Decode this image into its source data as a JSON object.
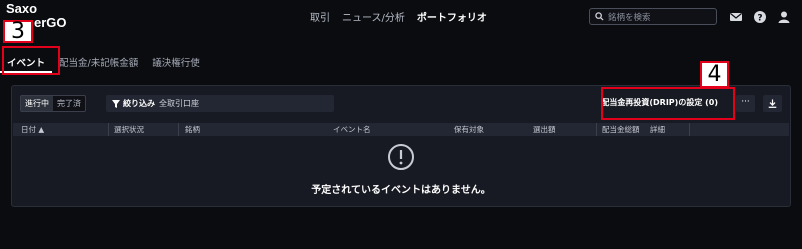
{
  "brand": {
    "line1": "Saxo",
    "line2": "erGO"
  },
  "annotations": {
    "step3": "3",
    "step4": "4"
  },
  "topnav": {
    "items": [
      "取引",
      "ニュース/分析",
      "ポートフォリオ"
    ]
  },
  "search": {
    "placeholder": "銘柄を検索"
  },
  "tabs": [
    "イベント",
    "配当金/未記帳金額",
    "議決権行使"
  ],
  "toolbar": {
    "status_toggle": [
      "進行中",
      "完了済"
    ],
    "filter_label": "絞り込み",
    "filter_value": "全取引口座",
    "drip_button": "配当金再投資(DRIP)の設定 (0)",
    "more_button": "···"
  },
  "table": {
    "columns": [
      "日付 ▲",
      "選択状況",
      "銘柄",
      "イベント名",
      "保有対象",
      "選出額",
      "配当金総額",
      "詳細"
    ]
  },
  "empty_state": {
    "message": "予定されているイベントはありません。"
  },
  "colors": {
    "highlight": "#e2001a",
    "background": "#0b0c10",
    "panel": "#171a22"
  }
}
